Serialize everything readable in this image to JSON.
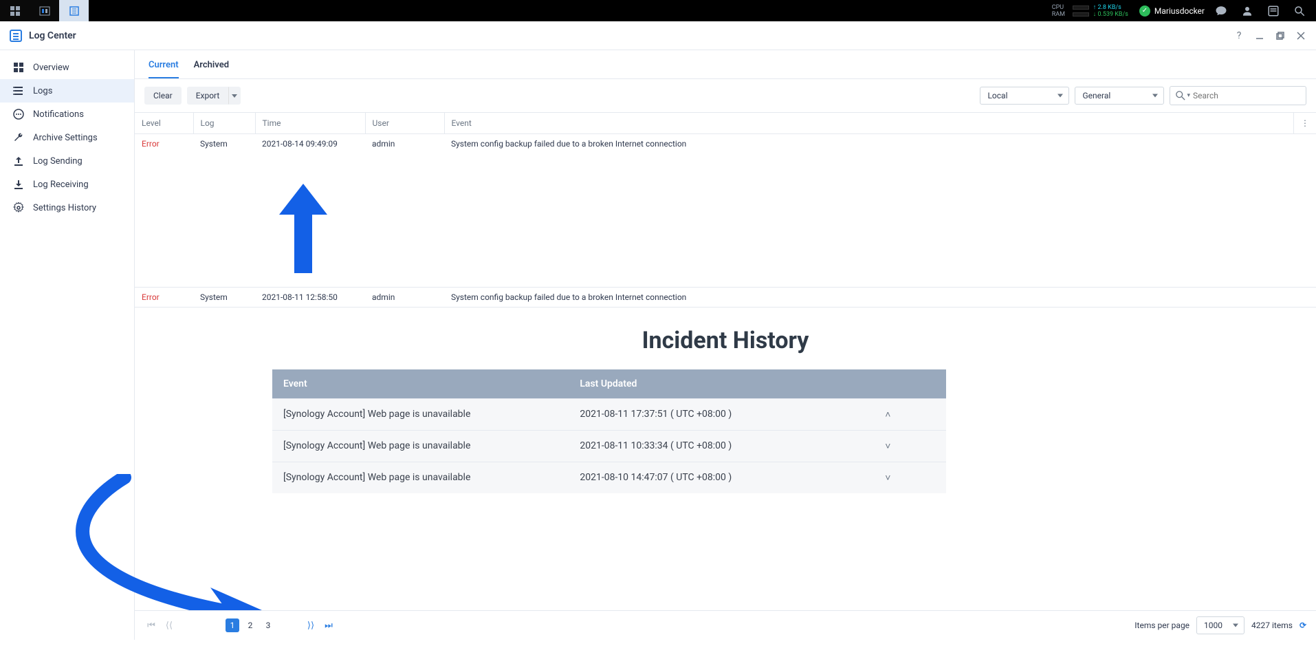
{
  "topbar": {
    "stats": {
      "cpu_label": "CPU",
      "ram_label": "RAM",
      "up_rate": "↑ 2.8 KB/s",
      "down_rate": "↓ 0.539 KB/s"
    },
    "username": "Mariusdocker"
  },
  "window": {
    "title": "Log Center"
  },
  "sidebar": {
    "items": [
      {
        "label": "Overview"
      },
      {
        "label": "Logs"
      },
      {
        "label": "Notifications"
      },
      {
        "label": "Archive Settings"
      },
      {
        "label": "Log Sending"
      },
      {
        "label": "Log Receiving"
      },
      {
        "label": "Settings History"
      }
    ]
  },
  "tabs": {
    "current": "Current",
    "archived": "Archived"
  },
  "toolbar": {
    "clear": "Clear",
    "export": "Export",
    "source_select": "Local",
    "category_select": "General",
    "search_placeholder": "Search"
  },
  "table": {
    "headers": {
      "level": "Level",
      "log": "Log",
      "time": "Time",
      "user": "User",
      "event": "Event"
    },
    "rows": [
      {
        "level": "Error",
        "log": "System",
        "time": "2021-08-14 09:49:09",
        "user": "admin",
        "event": "System config backup failed due to a broken Internet connection"
      },
      {
        "level": "Error",
        "log": "System",
        "time": "2021-08-11 12:58:50",
        "user": "admin",
        "event": "System config backup failed due to a broken Internet connection"
      }
    ]
  },
  "incident": {
    "title": "Incident History",
    "headers": {
      "event": "Event",
      "updated": "Last Updated"
    },
    "rows": [
      {
        "event": "[Synology Account] Web page is unavailable",
        "updated": "2021-08-11 17:37:51 ( UTC +08:00 )",
        "open": true
      },
      {
        "event": "[Synology Account] Web page is unavailable",
        "updated": "2021-08-11 10:33:34 ( UTC +08:00 )",
        "open": false
      },
      {
        "event": "[Synology Account] Web page is unavailable",
        "updated": "2021-08-10 14:47:07 ( UTC +08:00 )",
        "open": false
      }
    ]
  },
  "footer": {
    "items_per_page_label": "Items per page",
    "items_per_page": "1000",
    "total": "4227 items",
    "pages": [
      "1",
      "2",
      "3"
    ]
  }
}
